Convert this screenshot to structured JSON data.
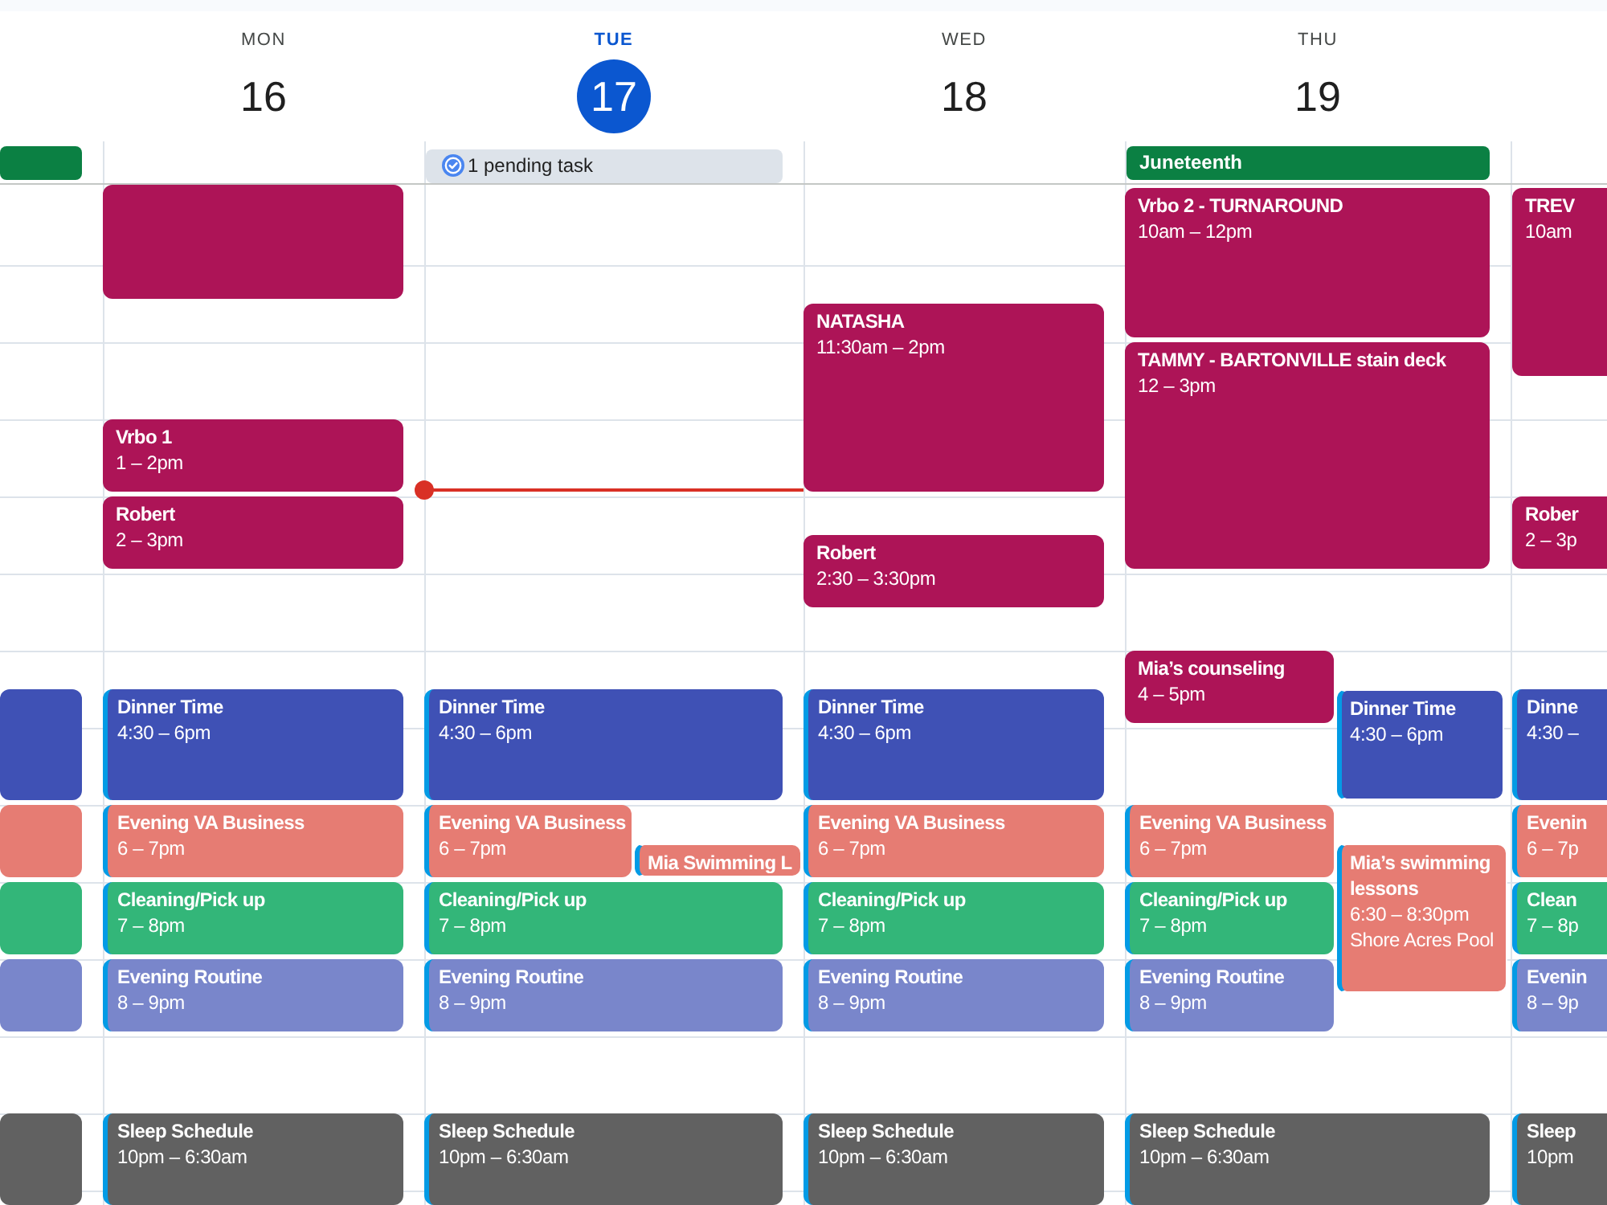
{
  "days": [
    {
      "current_time": false,
      "all_day": [
        {
          "kind": "event",
          "color": "#0b8043"
        }
      ],
      "events": [
        {
          "color": "#3f51b5",
          "stripe": false
        },
        {
          "color": "#e67c73",
          "stripe": false
        },
        {
          "color": "#33b679",
          "stripe": false
        },
        {
          "color": "#7986cb",
          "stripe": false
        },
        {
          "color": "#616161",
          "stripe": false
        }
      ]
    },
    {
      "weekday": "MON",
      "date": "16",
      "today": false,
      "current_time": false,
      "events": [
        {
          "color": "#ad1457",
          "stripe": false
        },
        {
          "title": "Vrbo 1",
          "time": "1 – 2pm",
          "color": "#ad1457",
          "stripe": false
        },
        {
          "title": "Robert",
          "time": "2 – 3pm",
          "color": "#ad1457",
          "stripe": false
        },
        {
          "title": "Dinner Time",
          "time": "4:30 – 6pm",
          "color": "#3f51b5",
          "stripe": true
        },
        {
          "title": "Evening VA Business",
          "time": "6 – 7pm",
          "color": "#e67c73",
          "stripe": true
        },
        {
          "title": "Cleaning/Pick up",
          "time": "7 – 8pm",
          "color": "#33b679",
          "stripe": true
        },
        {
          "title": "Evening Routine",
          "time": "8 – 9pm",
          "color": "#7986cb",
          "stripe": true
        },
        {
          "title": "Sleep Schedule",
          "time": "10pm – 6:30am",
          "color": "#616161",
          "stripe": true
        }
      ]
    },
    {
      "weekday": "TUE",
      "date": "17",
      "today": true,
      "current_time": true,
      "all_day": [
        {
          "kind": "task",
          "label": "1 pending task"
        }
      ],
      "events": [
        {
          "title": "Dinner Time",
          "time": "4:30 – 6pm",
          "color": "#3f51b5",
          "stripe": true
        },
        {
          "title": "Evening VA Business",
          "time": "6 – 7pm",
          "color": "#e67c73",
          "stripe": true
        },
        {
          "title": "Mia Swimming L",
          "color": "#e67c73",
          "stripe": true
        },
        {
          "title": "Cleaning/Pick up",
          "time": "7 – 8pm",
          "color": "#33b679",
          "stripe": true
        },
        {
          "title": "Evening Routine",
          "time": "8 – 9pm",
          "color": "#7986cb",
          "stripe": true
        },
        {
          "title": "Sleep Schedule",
          "time": "10pm – 6:30am",
          "color": "#616161",
          "stripe": true
        }
      ]
    },
    {
      "weekday": "WED",
      "date": "18",
      "today": false,
      "current_time": false,
      "events": [
        {
          "title": "NATASHA",
          "time": "11:30am – 2pm",
          "color": "#ad1457",
          "stripe": false
        },
        {
          "title": "Robert",
          "time": "2:30 – 3:30pm",
          "color": "#ad1457",
          "stripe": false
        },
        {
          "title": "Dinner Time",
          "time": "4:30 – 6pm",
          "color": "#3f51b5",
          "stripe": true
        },
        {
          "title": "Evening VA Business",
          "time": "6 – 7pm",
          "color": "#e67c73",
          "stripe": true
        },
        {
          "title": "Cleaning/Pick up",
          "time": "7 – 8pm",
          "color": "#33b679",
          "stripe": true
        },
        {
          "title": "Evening Routine",
          "time": "8 – 9pm",
          "color": "#7986cb",
          "stripe": true
        },
        {
          "title": "Sleep Schedule",
          "time": "10pm – 6:30am",
          "color": "#616161",
          "stripe": true
        }
      ]
    },
    {
      "weekday": "THU",
      "date": "19",
      "today": false,
      "current_time": false,
      "all_day": [
        {
          "kind": "event",
          "title": "Juneteenth",
          "color": "#0b8043"
        }
      ],
      "events": [
        {
          "title": "Vrbo 2 - TURNAROUND",
          "time": "10am – 12pm",
          "color": "#ad1457",
          "stripe": false
        },
        {
          "title": "TAMMY - BARTONVILLE stain deck",
          "time": "12 – 3pm",
          "color": "#ad1457",
          "stripe": false
        },
        {
          "title": "Mia’s counseling",
          "time": "4 – 5pm",
          "color": "#ad1457",
          "stripe": false
        },
        {
          "title": "Dinner Time",
          "time": "4:30 – 6pm",
          "color": "#3f51b5",
          "stripe": true
        },
        {
          "title": "Evening VA Business",
          "time": "6 – 7pm",
          "color": "#e67c73",
          "stripe": true
        },
        {
          "title": "Mia’s swimming lessons",
          "time": "6:30 – 8:30pm",
          "location": "Shore Acres Pool",
          "color": "#e67c73",
          "stripe": true
        },
        {
          "title": "Cleaning/Pick up",
          "time": "7 – 8pm",
          "color": "#33b679",
          "stripe": true
        },
        {
          "title": "Evening Routine",
          "time": "8 – 9pm",
          "color": "#7986cb",
          "stripe": true
        },
        {
          "title": "Sleep Schedule",
          "time": "10pm – 6:30am",
          "color": "#616161",
          "stripe": true
        }
      ]
    },
    {
      "current_time": false,
      "events": [
        {
          "title": "TREV",
          "time": "10am",
          "color": "#ad1457",
          "stripe": false
        },
        {
          "title": "Rober",
          "time": "2 – 3p",
          "color": "#ad1457",
          "stripe": false
        },
        {
          "title": "Dinne",
          "time": "4:30 –",
          "color": "#3f51b5",
          "stripe": true
        },
        {
          "title": "Evenin",
          "time": "6 – 7p",
          "color": "#e67c73",
          "stripe": true
        },
        {
          "title": "Clean",
          "time": "7 – 8p",
          "color": "#33b679",
          "stripe": true
        },
        {
          "title": "Evenin",
          "time": "8 – 9p",
          "color": "#7986cb",
          "stripe": true
        },
        {
          "title": "Sleep",
          "time": "10pm",
          "color": "#616161",
          "stripe": true
        }
      ]
    }
  ]
}
